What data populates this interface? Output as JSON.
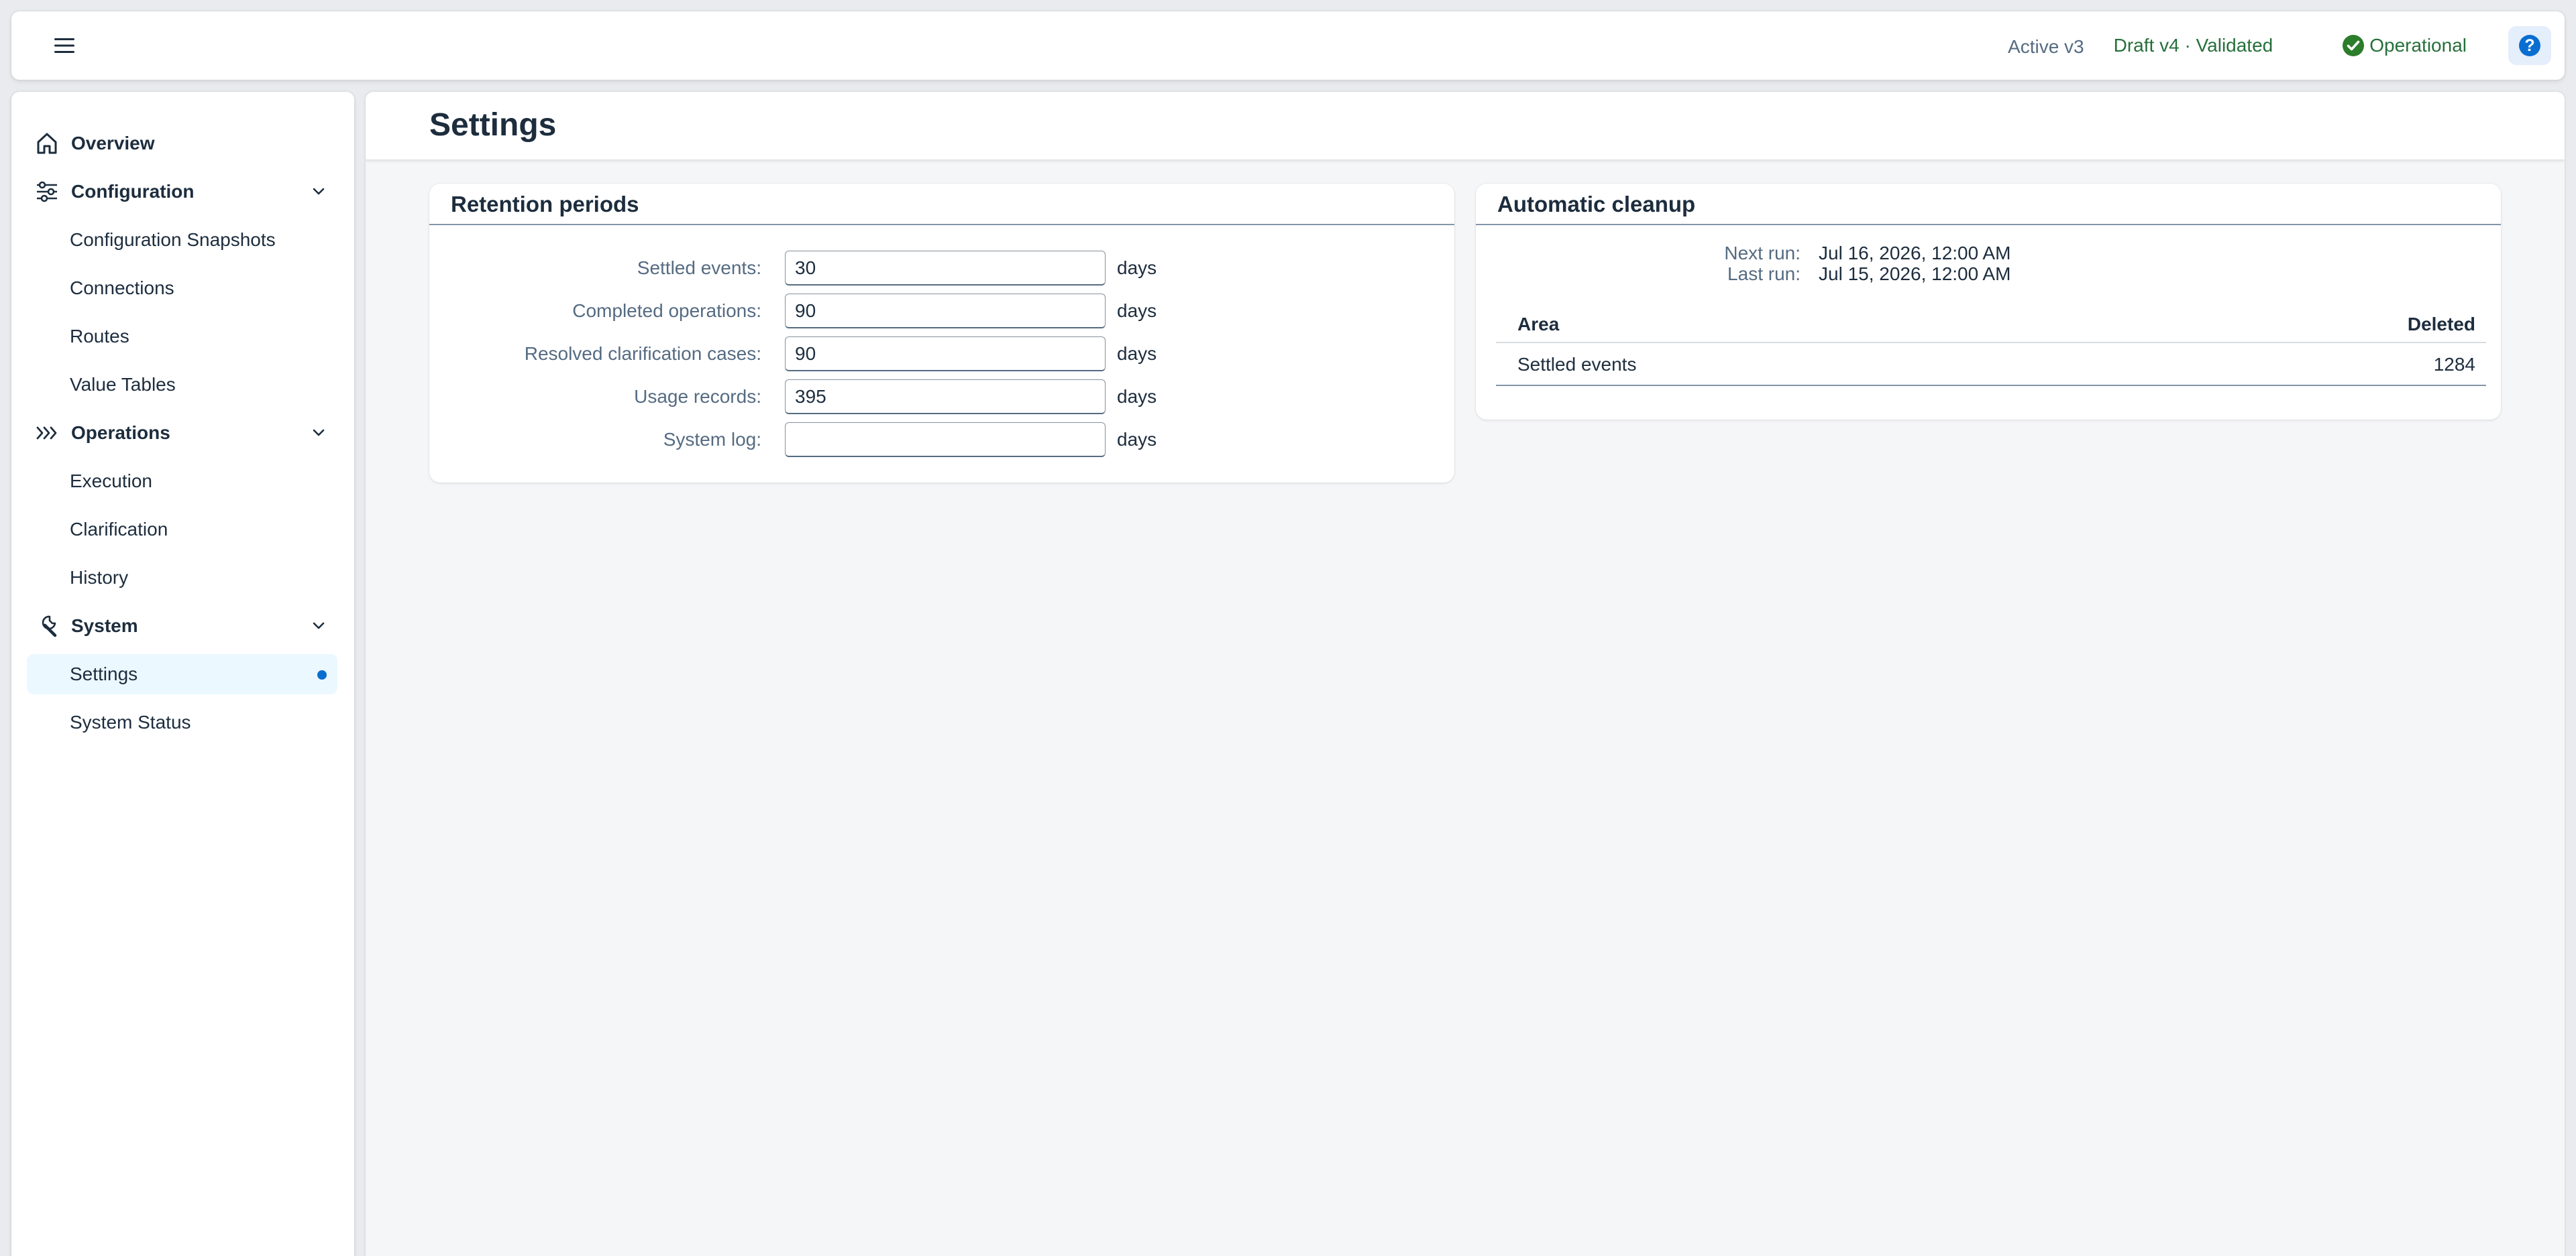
{
  "shell": {
    "menu_icon": "hamburger-menu-icon",
    "active_version": "Active v3",
    "draft_status": "Draft v4 · Validated",
    "system_status": "Operational",
    "status_color": "#256f3a",
    "help_icon": "help-icon"
  },
  "sidebar": {
    "items": [
      {
        "label": "Overview",
        "icon": "home-icon"
      },
      {
        "label": "Configuration",
        "icon": "sliders-icon"
      },
      {
        "label": "Configuration Snapshots"
      },
      {
        "label": "Connections"
      },
      {
        "label": "Routes"
      },
      {
        "label": "Value Tables"
      },
      {
        "label": "Operations",
        "icon": "double-chevron-right-icon"
      },
      {
        "label": "Execution"
      },
      {
        "label": "Clarification"
      },
      {
        "label": "History"
      },
      {
        "label": "System",
        "icon": "wrench-icon"
      },
      {
        "label": "Settings",
        "selected": true
      },
      {
        "label": "System Status"
      }
    ]
  },
  "page": {
    "title": "Settings"
  },
  "retention": {
    "title": "Retention periods",
    "unit": "days",
    "rows": [
      {
        "label": "Settled events:",
        "value": "30"
      },
      {
        "label": "Completed operations:",
        "value": "90"
      },
      {
        "label": "Resolved clarification cases:",
        "value": "90"
      },
      {
        "label": "Usage records:",
        "value": "395"
      },
      {
        "label": "System log:",
        "value": ""
      }
    ]
  },
  "cleanup": {
    "title": "Automatic cleanup",
    "next_run_label": "Next run:",
    "next_run_value": "Jul 16, 2026, 12:00 AM",
    "last_run_label": "Last run:",
    "last_run_value": "Jul 15, 2026, 12:00 AM",
    "table": {
      "columns": [
        "Area",
        "Deleted"
      ],
      "rows": [
        {
          "area": "Settled events",
          "deleted": "1284"
        }
      ]
    }
  }
}
